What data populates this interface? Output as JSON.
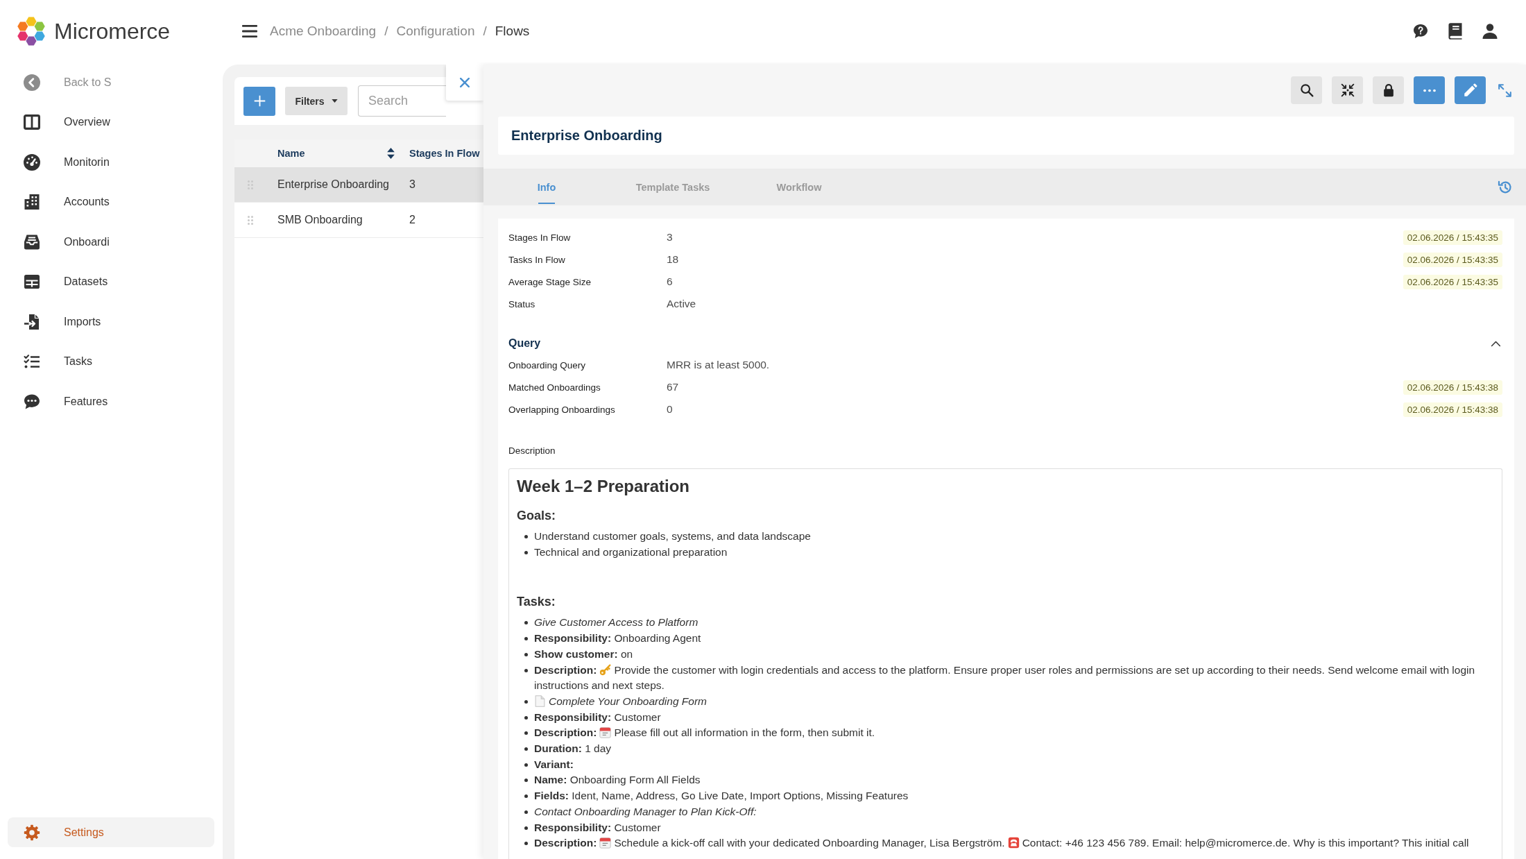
{
  "header": {
    "app_name": "Micromerce",
    "breadcrumb": [
      {
        "label": "Acme Onboarding",
        "current": false
      },
      {
        "separator": "/",
        "label": "Configuration",
        "current": false
      },
      {
        "separator": "/",
        "label": "Flows",
        "current": true
      }
    ]
  },
  "sidebar": {
    "items": [
      {
        "kind": "back",
        "label": "Back to S",
        "selected": false
      },
      {
        "kind": "link",
        "label": "Overview",
        "selected": false
      },
      {
        "kind": "link",
        "label": "Monitorin",
        "selected": false
      },
      {
        "kind": "link",
        "label": "Accounts",
        "selected": false
      },
      {
        "kind": "link",
        "label": "Onboardi",
        "selected": false
      },
      {
        "kind": "link",
        "label": "Datasets",
        "selected": false
      },
      {
        "kind": "link",
        "label": "Imports",
        "selected": false
      },
      {
        "kind": "link",
        "label": "Tasks",
        "selected": false
      },
      {
        "kind": "link",
        "label": "Features",
        "selected": false
      }
    ],
    "bottom_items": [
      {
        "kind": "link",
        "label": "Settings",
        "selected": true
      }
    ]
  },
  "list": {
    "toolbar": {
      "filters": "Filters",
      "search": {
        "placeholder": "Search"
      }
    },
    "table": {
      "columns": [
        {
          "label": "Name",
          "sortable": true
        },
        {
          "label": "Stages In Flow",
          "sortable": false
        }
      ],
      "rows": [
        {
          "name": "Enterprise Onboarding",
          "stages": "3",
          "selected": true
        },
        {
          "name": "SMB Onboarding",
          "stages": "2",
          "selected": false
        }
      ]
    }
  },
  "detail": {
    "title": "Enterprise Onboarding",
    "tabs": [
      {
        "label": "Info",
        "selected": true
      },
      {
        "label": "Template Tasks",
        "selected": false
      },
      {
        "label": "Workflow",
        "selected": false
      }
    ],
    "fields": [
      {
        "label": "Stages In Flow",
        "value": "3",
        "timestamp": "02.06.2026 / 15:43:35"
      },
      {
        "label": "Tasks In Flow",
        "value": "18",
        "timestamp": "02.06.2026 / 15:43:35"
      },
      {
        "label": "Average Stage Size",
        "value": "6",
        "timestamp": "02.06.2026 / 15:43:35"
      },
      {
        "label": "Status",
        "value": "Active"
      }
    ],
    "query": {
      "heading": "Query",
      "expanded": true,
      "fields": [
        {
          "label": "Onboarding Query",
          "value": "MRR is at least 5000."
        },
        {
          "label": "Matched Onboardings",
          "value": "67",
          "timestamp": "02.06.2026 / 15:43:38"
        },
        {
          "label": "Overlapping Onboardings",
          "value": "0",
          "timestamp": "02.06.2026 / 15:43:38"
        }
      ]
    },
    "description": {
      "label": "Description",
      "title": "Week 1–2 Preparation",
      "sections": [
        {
          "heading": "Goals:",
          "items": [
            {
              "kind": "plain",
              "text": "Understand customer goals, systems, and data landscape"
            },
            {
              "kind": "plain",
              "text": "Technical and organizational preparation"
            }
          ]
        },
        {
          "heading": "Tasks:",
          "items": [
            {
              "kind": "italic",
              "text": "Give Customer Access to Platform"
            },
            {
              "kind": "plain",
              "text": "**Responsibility:** Onboarding Agent"
            },
            {
              "kind": "plain",
              "text": "**Show customer:** on"
            },
            {
              "kind": "plain",
              "parts": [
                {
                  "kind": "label",
                  "text": "Description:"
                },
                {
                  "kind": "key"
                },
                {
                  "kind": "text",
                  "text": "Provide the customer with login credentials and access to the platform. Ensure proper user roles and permissions are set up according to their needs. Send welcome email with login instructions and next steps."
                }
              ]
            },
            {
              "kind": "italic",
              "parts": [
                {
                  "kind": "document"
                },
                {
                  "kind": "text",
                  "text": "Complete Your Onboarding Form"
                }
              ]
            },
            {
              "kind": "plain",
              "text": "**Responsibility:** Customer"
            },
            {
              "kind": "plain",
              "parts": [
                {
                  "kind": "label",
                  "text": "Description:"
                },
                {
                  "kind": "calendar"
                },
                {
                  "kind": "text",
                  "text": "Please fill out all information in the form, then submit it."
                }
              ]
            },
            {
              "kind": "plain",
              "text": "**Duration:** 1 day"
            },
            {
              "kind": "plain",
              "text": "**Variant:**"
            },
            {
              "kind": "plain",
              "text": "**Name:** Onboarding Form All Fields"
            },
            {
              "kind": "plain",
              "text": "**Fields:** Ident, Name, Address, Go Live Date, Import Options, Missing Features"
            },
            {
              "kind": "italic",
              "text": "Contact Onboarding Manager to Plan Kick-Off:"
            },
            {
              "kind": "plain",
              "text": "**Responsibility:** Customer"
            },
            {
              "kind": "plain",
              "parts": [
                {
                  "kind": "label",
                  "text": "Description:"
                },
                {
                  "kind": "calendar"
                },
                {
                  "kind": "text",
                  "text": "Schedule a kick-off call with your dedicated Onboarding Manager, Lisa Bergström."
                },
                {
                  "kind": "telephone"
                },
                {
                  "kind": "text",
                  "text": "Contact: +46 123 456 789. Email: help@micromerce.de. Why is this important? This initial call"
                }
              ]
            }
          ]
        }
      ]
    }
  }
}
